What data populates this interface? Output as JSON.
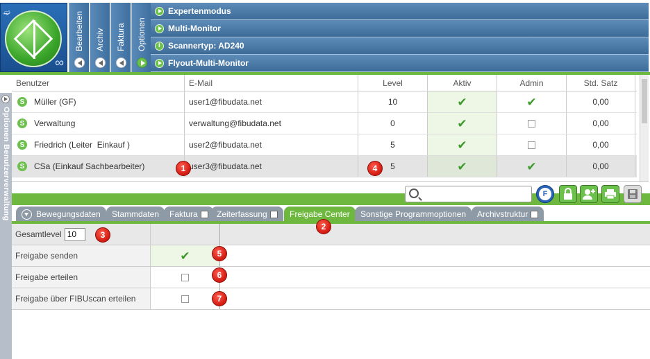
{
  "header": {
    "vtabs": [
      {
        "label": "Bearbeiten"
      },
      {
        "label": "Archiv"
      },
      {
        "label": "Faktura"
      },
      {
        "label": "Optionen"
      }
    ],
    "menu_rows": [
      {
        "label": "Expertenmodus",
        "icon": "arrow"
      },
      {
        "label": "Multi-Monitor",
        "icon": "arrow"
      },
      {
        "label": "Scannertyp: AD240",
        "icon": "info"
      },
      {
        "label": "Flyout-Multi-Monitor",
        "icon": "arrow"
      }
    ]
  },
  "sidebar": {
    "label": "Optionen Benutzerverwaltung"
  },
  "user_table": {
    "columns": [
      "Benutzer",
      "E-Mail",
      "Level",
      "Aktiv",
      "Admin",
      "Std. Satz"
    ],
    "rows": [
      {
        "name": "Müller (GF)",
        "email": "user1@fibudata.net",
        "level": "10",
        "aktiv": true,
        "admin": true,
        "satz": "0,00"
      },
      {
        "name": "Verwaltung",
        "email": "verwaltung@fibudata.net",
        "level": "0",
        "aktiv": true,
        "admin": false,
        "satz": "0,00"
      },
      {
        "name": "Friedrich (Leiter  Einkauf )",
        "email": "user2@fibudata.net",
        "level": "5",
        "aktiv": true,
        "admin": false,
        "satz": "0,00"
      },
      {
        "name": "CSa (Einkauf Sachbearbeiter)",
        "email": "user3@fibudata.net",
        "level": "5",
        "aktiv": true,
        "admin": true,
        "satz": "0,00"
      }
    ]
  },
  "toolbar": {
    "search_value": "",
    "f_button": "F"
  },
  "tabs": [
    {
      "label": "Bewegungsdaten",
      "dropdown": true,
      "checkbox": false,
      "active": false
    },
    {
      "label": "Stammdaten",
      "dropdown": false,
      "checkbox": false,
      "active": false
    },
    {
      "label": "Faktura",
      "dropdown": false,
      "checkbox": true,
      "active": false
    },
    {
      "label": "Zeiterfassung",
      "dropdown": false,
      "checkbox": true,
      "active": false
    },
    {
      "label": "Freigabe Center",
      "dropdown": false,
      "checkbox": false,
      "active": true
    },
    {
      "label": "Sonstige Programmoptionen",
      "dropdown": false,
      "checkbox": false,
      "active": false
    },
    {
      "label": "Archivstruktur",
      "dropdown": false,
      "checkbox": true,
      "active": false
    }
  ],
  "approval": {
    "gesamtlevel_label": "Gesamtlevel",
    "gesamtlevel_value": "10",
    "rows": [
      {
        "label": "Freigabe senden",
        "checked": true
      },
      {
        "label": "Freigabe erteilen",
        "checked": false
      },
      {
        "label": "Freigabe über FIBUscan erteilen",
        "checked": false
      }
    ]
  },
  "markers": [
    "1",
    "2",
    "3",
    "4",
    "5",
    "6",
    "7"
  ],
  "colors": {
    "accent_green": "#6fb83f",
    "header_blue": "#3e6c99",
    "tab_grey": "#8e9aa6",
    "marker_red": "#d21a10"
  }
}
